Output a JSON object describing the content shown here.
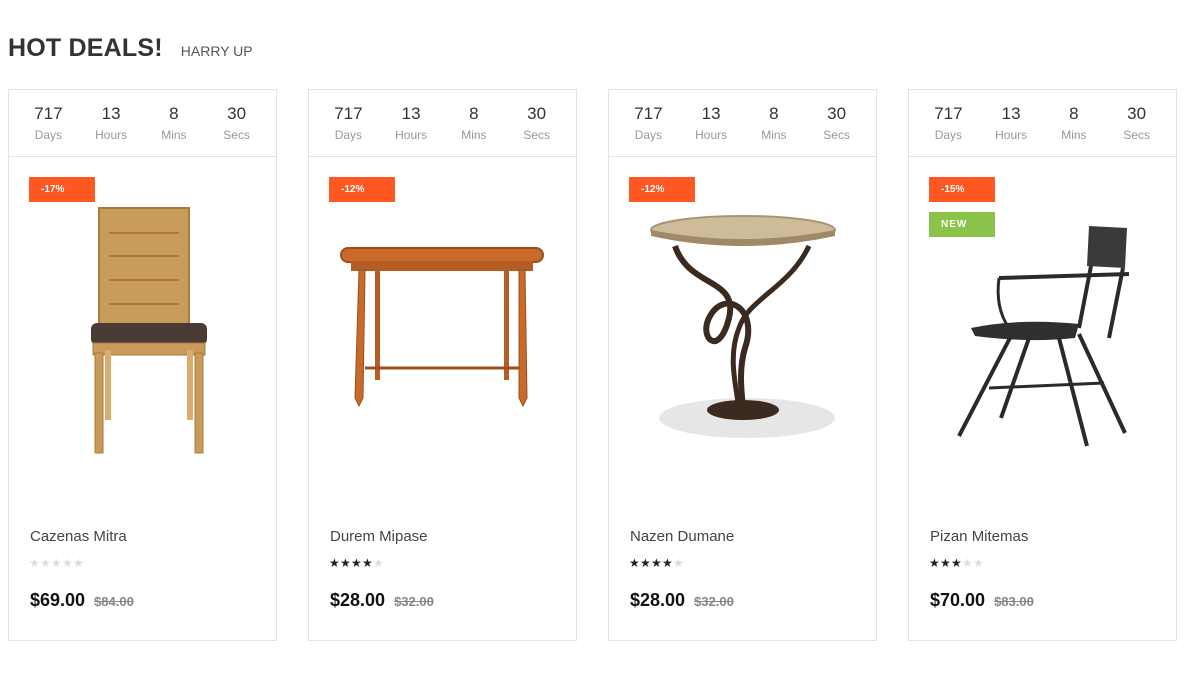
{
  "section": {
    "title": "HOT DEALS!",
    "subtitle": "HARRY UP"
  },
  "colors": {
    "sale_badge": "#ff5722",
    "new_badge": "#8bc34a",
    "border": "#e3e3e3"
  },
  "products": [
    {
      "countdown": [
        {
          "value": "717",
          "label": "Days"
        },
        {
          "value": "13",
          "label": "Hours"
        },
        {
          "value": "8",
          "label": "Mins"
        },
        {
          "value": "30",
          "label": "Secs"
        }
      ],
      "discount": "-17%",
      "new_badge": "",
      "image": "wooden-chair",
      "name": "Cazenas Mitra",
      "rating": 0,
      "price": "$69.00",
      "old_price": "$84.00"
    },
    {
      "countdown": [
        {
          "value": "717",
          "label": "Days"
        },
        {
          "value": "13",
          "label": "Hours"
        },
        {
          "value": "8",
          "label": "Mins"
        },
        {
          "value": "30",
          "label": "Secs"
        }
      ],
      "discount": "-12%",
      "new_badge": "",
      "image": "wooden-table",
      "name": "Durem Mipase",
      "rating": 4,
      "price": "$28.00",
      "old_price": "$32.00"
    },
    {
      "countdown": [
        {
          "value": "717",
          "label": "Days"
        },
        {
          "value": "13",
          "label": "Hours"
        },
        {
          "value": "8",
          "label": "Mins"
        },
        {
          "value": "30",
          "label": "Secs"
        }
      ],
      "discount": "-12%",
      "new_badge": "",
      "image": "round-side-table",
      "name": "Nazen Dumane",
      "rating": 3.5,
      "price": "$28.00",
      "old_price": "$32.00"
    },
    {
      "countdown": [
        {
          "value": "717",
          "label": "Days"
        },
        {
          "value": "13",
          "label": "Hours"
        },
        {
          "value": "8",
          "label": "Mins"
        },
        {
          "value": "30",
          "label": "Secs"
        }
      ],
      "discount": "-15%",
      "new_badge": "NEW",
      "image": "metal-chair",
      "name": "Pizan Mitemas",
      "rating": 3,
      "price": "$70.00",
      "old_price": "$83.00"
    }
  ]
}
